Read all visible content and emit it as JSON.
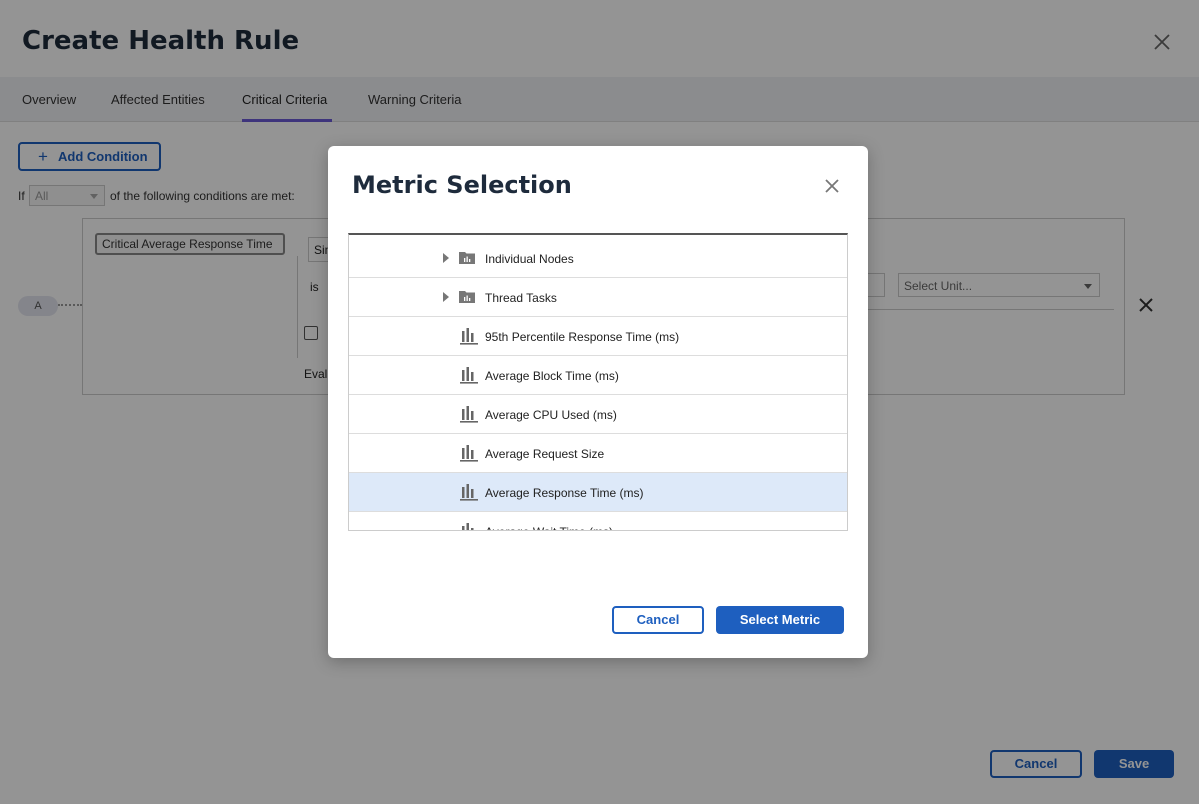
{
  "page": {
    "title": "Create Health Rule",
    "tabs": [
      {
        "label": "Overview"
      },
      {
        "label": "Affected Entities"
      },
      {
        "label": "Critical Criteria",
        "active": true
      },
      {
        "label": "Warning Criteria"
      }
    ],
    "add_condition_label": "Add Condition",
    "if_label": "If",
    "match_select_value": "All",
    "of_label": "of the following conditions are met:",
    "condition": {
      "badge": "A",
      "name": "Critical Average Response Time",
      "sim_field_value": "Sin",
      "is_label": "is",
      "eval_label": "Evalu",
      "unit_placeholder": "Select Unit..."
    },
    "footer": {
      "cancel_label": "Cancel",
      "save_label": "Save"
    }
  },
  "modal": {
    "title": "Metric Selection",
    "items": [
      {
        "label": "Individual Nodes",
        "type": "folder",
        "icon": "folder-icon"
      },
      {
        "label": "Thread Tasks",
        "type": "folder",
        "icon": "folder-icon"
      },
      {
        "label": "95th Percentile Response Time (ms)",
        "type": "metric",
        "icon": "bar-chart-icon"
      },
      {
        "label": "Average Block Time (ms)",
        "type": "metric",
        "icon": "bar-chart-icon"
      },
      {
        "label": "Average CPU Used (ms)",
        "type": "metric",
        "icon": "bar-chart-icon"
      },
      {
        "label": "Average Request Size",
        "type": "metric",
        "icon": "bar-chart-icon"
      },
      {
        "label": "Average Response Time (ms)",
        "type": "metric",
        "icon": "bar-chart-icon",
        "selected": true
      },
      {
        "label": "Average Wait Time (ms)",
        "type": "metric",
        "icon": "bar-chart-icon"
      }
    ],
    "cancel_label": "Cancel",
    "select_label": "Select Metric"
  },
  "colors": {
    "primary": "#1e5fbf",
    "selected_row": "#dde9f9",
    "tab_accent": "#6b5bd6"
  }
}
